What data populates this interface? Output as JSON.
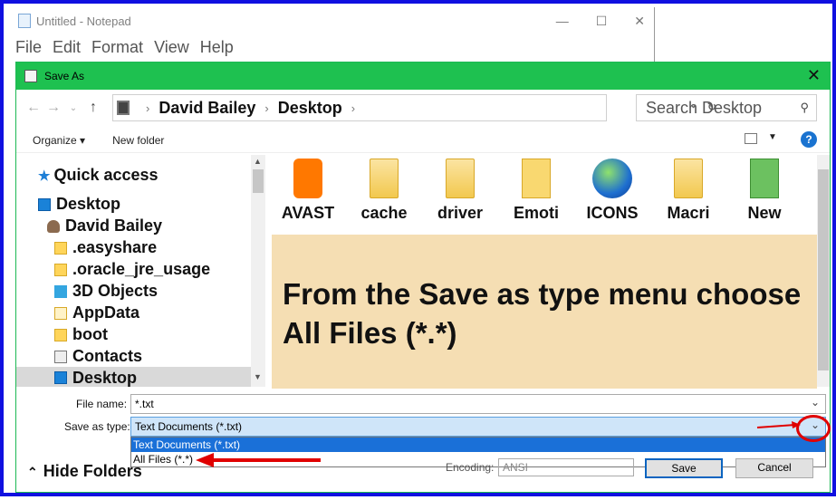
{
  "notepad": {
    "title": "Untitled - Notepad",
    "menu": [
      "File",
      "Edit",
      "Format",
      "View",
      "Help"
    ],
    "controls": [
      "—",
      "☐",
      "✕"
    ]
  },
  "dialog": {
    "title": "Save As",
    "close": "✕",
    "back": "←",
    "forward": "→",
    "recent": "⌄",
    "up": "↑",
    "breadcrumb": [
      "David Bailey",
      "Desktop"
    ],
    "search_placeholder": "Search Desktop",
    "toolbar": {
      "organize": "Organize ▾",
      "new_folder": "New folder",
      "help": "?"
    },
    "nav": {
      "quick_access": "Quick access",
      "items": [
        "Desktop",
        "David Bailey",
        ".easyshare",
        ".oracle_jre_usage",
        "3D Objects",
        "AppData",
        "boot",
        "Contacts",
        "Desktop"
      ]
    },
    "files": [
      "AVAST",
      "cache",
      "driver",
      "Emoti",
      "ICONS",
      "Macri",
      "New"
    ],
    "note": "From the Save as type menu choose All Files (*.*)",
    "file_name_label": "File name:",
    "file_name_value": "*.txt",
    "save_type_label": "Save as type:",
    "save_type_value": "Text Documents (*.txt)",
    "save_type_options": [
      "Text Documents (*.txt)",
      "All Files  (*.*)"
    ],
    "hide_folders": "Hide Folders",
    "encoding_label": "Encoding:",
    "encoding_value": "ANSI",
    "save_button": "Save",
    "cancel_button": "Cancel"
  },
  "colors": {
    "titlebar": "#1ec150",
    "frame": "#1010e0",
    "annotation": "#e00000",
    "note_bg": "#f5deb3"
  }
}
